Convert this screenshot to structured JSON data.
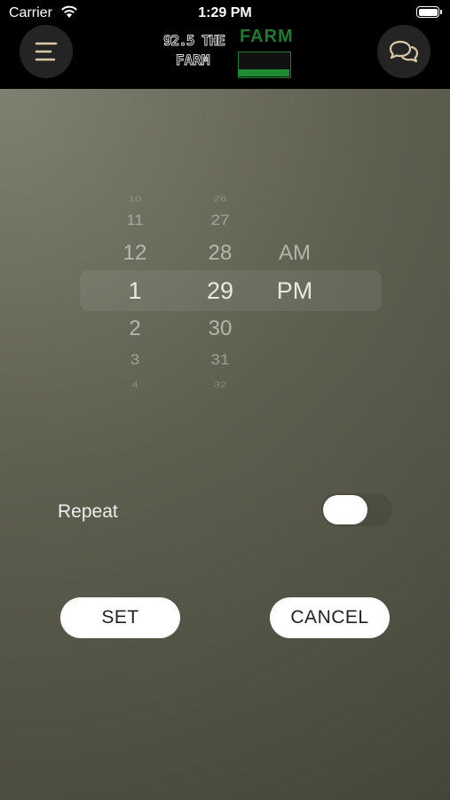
{
  "status_bar": {
    "carrier": "Carrier",
    "time": "1:29 PM"
  },
  "header": {
    "menu_icon": "menu-lines-icon",
    "chat_icon": "chat-bubbles-icon",
    "logo": {
      "line1": "92.5 THE",
      "line2": "FARM",
      "farm": "FARM"
    }
  },
  "picker": {
    "hours": [
      "10",
      "11",
      "12",
      "1",
      "2",
      "3",
      "4"
    ],
    "minutes": [
      "26",
      "27",
      "28",
      "29",
      "30",
      "31",
      "32"
    ],
    "ampm": [
      "AM",
      "PM"
    ],
    "selected": {
      "hour": "1",
      "minute": "29",
      "ampm": "PM"
    }
  },
  "repeat": {
    "label": "Repeat",
    "enabled": false
  },
  "buttons": {
    "set": "SET",
    "cancel": "CANCEL"
  },
  "colors": {
    "header_bg": "#000000",
    "background": "#5e5f4f",
    "button_bg": "#ffffff",
    "logo_green": "#1e7a2e"
  }
}
